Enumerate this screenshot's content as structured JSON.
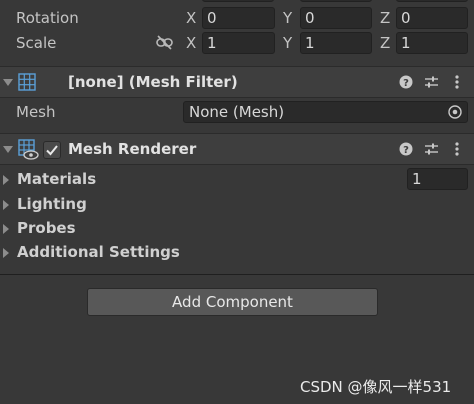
{
  "transform": {
    "rotation_label": "Rotation",
    "scale_label": "Scale",
    "rotation": {
      "x_label": "X",
      "x": "0",
      "y_label": "Y",
      "y": "0",
      "z_label": "Z",
      "z": "0"
    },
    "scale": {
      "x_label": "X",
      "x": "1",
      "y_label": "Y",
      "y": "1",
      "z_label": "Z",
      "z": "1"
    }
  },
  "mesh_filter": {
    "title": "[none] (Mesh Filter)",
    "mesh_label": "Mesh",
    "mesh_value": "None (Mesh)"
  },
  "mesh_renderer": {
    "title": "Mesh Renderer",
    "enabled": true,
    "foldouts": {
      "materials": "Materials",
      "materials_count": "1",
      "lighting": "Lighting",
      "probes": "Probes",
      "additional": "Additional Settings"
    }
  },
  "add_component_label": "Add Component",
  "watermark": "CSDN @像风一样531"
}
